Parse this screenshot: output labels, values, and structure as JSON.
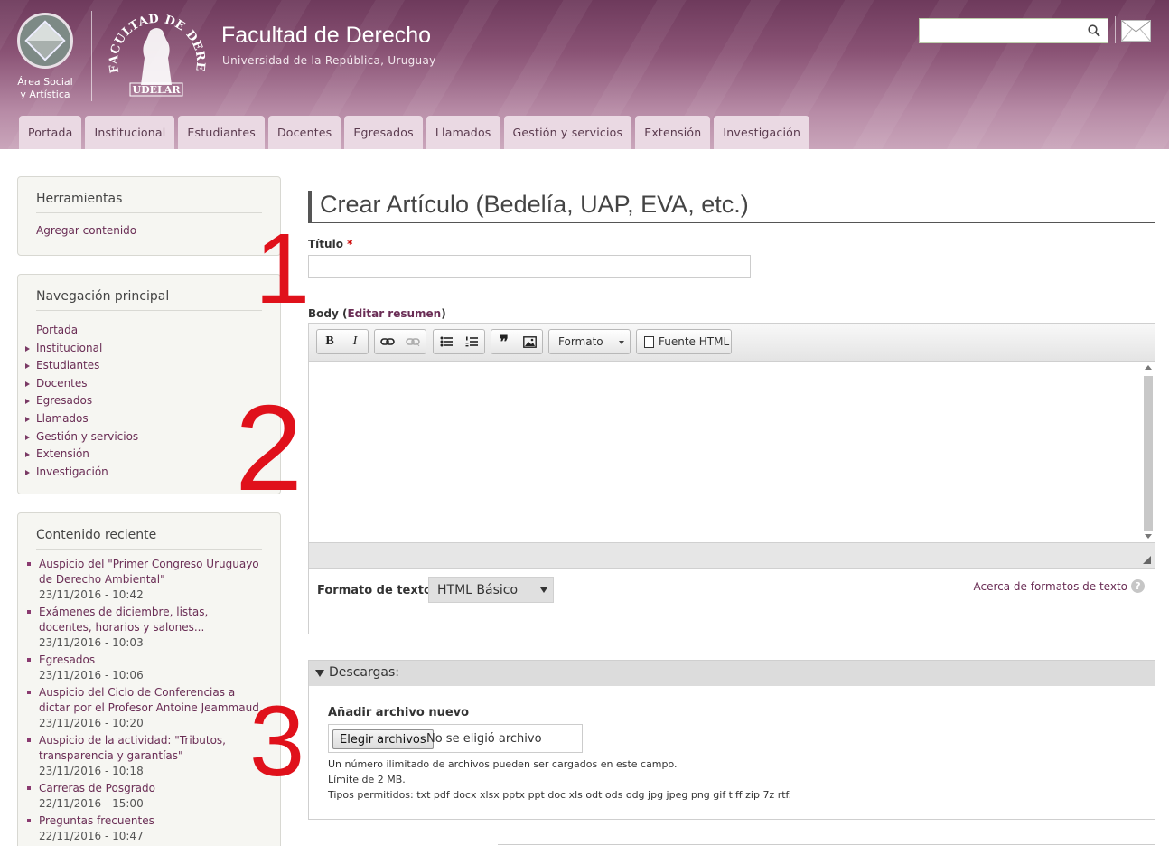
{
  "header": {
    "logo_text_line1": "Área Social",
    "logo_text_line2": "y Artística",
    "seal_text_top": "FACULTAD DE DERECHO",
    "seal_text_bottom": "UDELAR",
    "title": "Facultad de Derecho",
    "subtitle": "Universidad de la República, Uruguay",
    "search_placeholder": "",
    "search_icon": "search-icon",
    "mail_icon": "mail-icon"
  },
  "nav": {
    "tabs": [
      "Portada",
      "Institucional",
      "Estudiantes",
      "Docentes",
      "Egresados",
      "Llamados",
      "Gestión y servicios",
      "Extensión",
      "Investigación"
    ]
  },
  "sidebar": {
    "tools": {
      "title": "Herramientas",
      "link": "Agregar contenido"
    },
    "main_nav": {
      "title": "Navegación principal",
      "items": [
        "Portada",
        "Institucional",
        "Estudiantes",
        "Docentes",
        "Egresados",
        "Llamados",
        "Gestión y servicios",
        "Extensión",
        "Investigación"
      ]
    },
    "recent": {
      "title": "Contenido reciente",
      "items": [
        {
          "title_l1": "Auspicio del \"Primer Congreso Uruguayo",
          "title_l2": "de Derecho Ambiental\"",
          "date": "23/11/2016 - 10:42"
        },
        {
          "title_l1": "Exámenes de diciembre, listas,",
          "title_l2": "docentes, horarios y salones...",
          "date": "23/11/2016 - 10:03"
        },
        {
          "title_l1": "Egresados",
          "title_l2": "",
          "date": "23/11/2016 - 10:06"
        },
        {
          "title_l1": "Auspicio del Ciclo de Conferencias a",
          "title_l2": "dictar por el Profesor Antoine Jeammaud",
          "date": "23/11/2016 - 10:20"
        },
        {
          "title_l1": "Auspicio de la actividad: \"Tributos,",
          "title_l2": "transparencia y garantías\"",
          "date": "23/11/2016 - 10:18"
        },
        {
          "title_l1": "Carreras de Posgrado",
          "title_l2": "",
          "date": "22/11/2016 - 15:00"
        },
        {
          "title_l1": "Preguntas frecuentes",
          "title_l2": "",
          "date": "22/11/2016 - 10:47"
        }
      ]
    }
  },
  "main": {
    "page_title": "Crear Artículo (Bedelía, UAP, EVA, etc.)",
    "titulo_label": "Título",
    "required_mark": "*",
    "titulo_value": "",
    "body_label": "Body (",
    "body_summary_link": "Editar resumen",
    "body_label_close": ")",
    "toolbar": {
      "bold": "B",
      "italic": "I",
      "format_label": "Formato",
      "source_label": "Fuente HTML"
    },
    "text_format_label": "Formato de texto",
    "text_format_value": "HTML Básico",
    "text_format_about": "Acerca de formatos de texto",
    "help": "?",
    "downloads": {
      "legend": "Descargas:",
      "add_label": "Añadir archivo nuevo",
      "choose_button": "Elegir archivos",
      "no_file": "No se eligió archivo",
      "desc1": "Un número ilimitado de archivos pueden ser cargados en este campo.",
      "desc2": "Límite de 2 MB.",
      "desc3": "Tipos permitidos: txt pdf docx xlsx pptx ppt doc xls odt ods odg jpg jpeg png gif tiff zip 7z rtf."
    }
  },
  "annotations": [
    "1",
    "2",
    "3"
  ],
  "colors": {
    "accent": "#6a2d55",
    "header": "#8a5375",
    "annotation": "#e0111b"
  }
}
